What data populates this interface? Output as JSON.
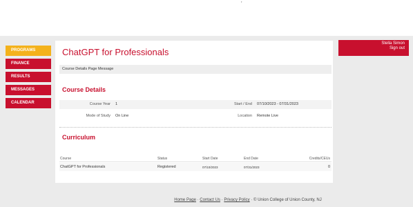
{
  "top_mark": "’",
  "nav": {
    "items": [
      {
        "label": "PROGRAMS",
        "active": true
      },
      {
        "label": "FINANCE",
        "active": false
      },
      {
        "label": "RESULTS",
        "active": false
      },
      {
        "label": "MESSAGES",
        "active": false
      },
      {
        "label": "CALENDAR",
        "active": false
      }
    ]
  },
  "user": {
    "name": "Stella Simon",
    "signout": "Sign out"
  },
  "page": {
    "title": "ChatGPT for Professionals",
    "message": "Course Details Page Message"
  },
  "details": {
    "section_title": "Course Details",
    "course_year_label": "Course Year",
    "course_year_value": "1",
    "start_end_label": "Start / End",
    "start_end_value": "07/10/2023 - 07/31/2023",
    "mode_label": "Mode of Study",
    "mode_value": "On Line",
    "location_label": "Location",
    "location_value": "Remote Live"
  },
  "curriculum": {
    "section_title": "Curriculum",
    "headers": [
      "Course",
      "Status",
      "Start Date",
      "End Date",
      "Credits/CEUs"
    ],
    "rows": [
      [
        "ChatGPT for Professionals",
        "Registered",
        "07/10/2023",
        "07/31/2023",
        "0"
      ]
    ]
  },
  "footer": {
    "home": "Home Page",
    "contact": "Contact Us",
    "privacy": "Privacy Policy",
    "copyright": "© Union College of Union County, NJ",
    "sep": " · "
  },
  "colors": {
    "accent": "#c8102e",
    "active_nav": "#f4b21c",
    "background": "#ebebeb"
  }
}
